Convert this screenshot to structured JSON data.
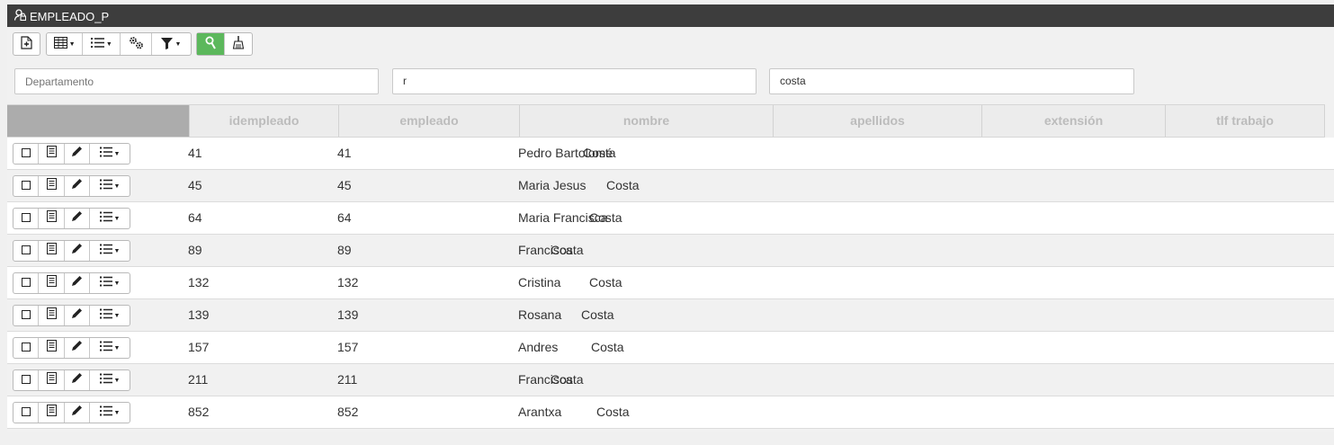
{
  "window": {
    "title": "EMPLEADO_P",
    "title_icon": "user-lock-icon"
  },
  "toolbar": {
    "buttons": [
      {
        "name": "new-record-button",
        "icon": "file-plus-icon"
      },
      {
        "name": "grid-view-button",
        "icon": "grid-icon",
        "has_caret": true
      },
      {
        "name": "list-menu-button",
        "icon": "list-icon",
        "has_caret": true
      },
      {
        "name": "settings-button",
        "icon": "gears-icon"
      },
      {
        "name": "filter-button",
        "icon": "funnel-icon",
        "has_caret": true
      },
      {
        "name": "search-button",
        "icon": "search-icon",
        "active": true
      },
      {
        "name": "clear-button",
        "icon": "broom-icon"
      }
    ],
    "accent_color": "#5cb85c"
  },
  "filters": {
    "departamento": {
      "placeholder": "Departamento",
      "value": ""
    },
    "nombre": {
      "value": "r"
    },
    "apellidos": {
      "value": "costa"
    }
  },
  "table": {
    "columns": [
      "idempleado",
      "empleado",
      "nombre",
      "apellidos",
      "extensión",
      "tlf trabajo"
    ],
    "row_actions": [
      "checkbox-icon",
      "detail-icon",
      "pencil-icon",
      "list-icon"
    ],
    "rows": [
      {
        "idempleado": "41",
        "empleado": "41",
        "nombre": "Pedro Bartolomé",
        "apellidos": "Costa"
      },
      {
        "idempleado": "45",
        "empleado": "45",
        "nombre": "Maria Jesus",
        "apellidos": "Costa"
      },
      {
        "idempleado": "64",
        "empleado": "64",
        "nombre": "Maria Francisca",
        "apellidos": "Costa"
      },
      {
        "idempleado": "89",
        "empleado": "89",
        "nombre": "Francisca",
        "apellidos": "Costa"
      },
      {
        "idempleado": "132",
        "empleado": "132",
        "nombre": "Cristina",
        "apellidos": "Costa"
      },
      {
        "idempleado": "139",
        "empleado": "139",
        "nombre": "Rosana",
        "apellidos": "Costa"
      },
      {
        "idempleado": "157",
        "empleado": "157",
        "nombre": "Andres",
        "apellidos": "Costa"
      },
      {
        "idempleado": "211",
        "empleado": "211",
        "nombre": "Francisca",
        "apellidos": "Costa"
      },
      {
        "idempleado": "852",
        "empleado": "852",
        "nombre": "Arantxa",
        "apellidos": "Costa"
      }
    ]
  }
}
